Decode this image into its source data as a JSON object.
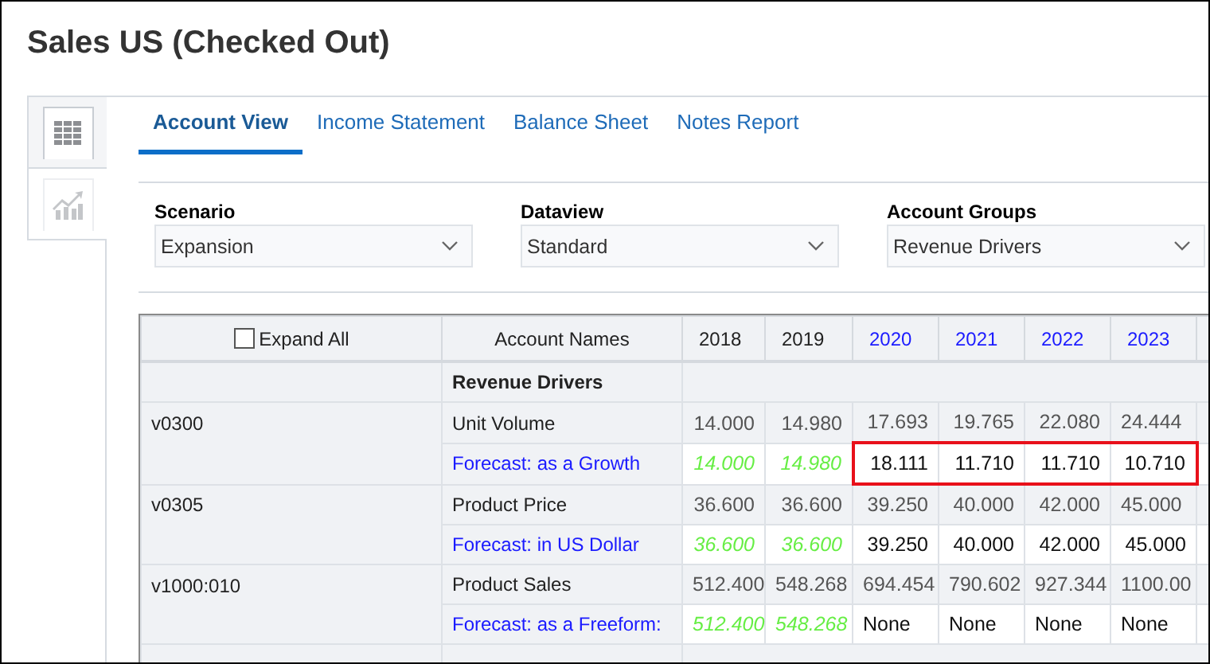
{
  "title": "Sales US (Checked Out)",
  "side_tabs": [
    {
      "kind": "grid",
      "selected": true
    },
    {
      "kind": "chart",
      "selected": false
    }
  ],
  "tabs": [
    {
      "label": "Account View",
      "selected": true
    },
    {
      "label": "Income Statement",
      "selected": false
    },
    {
      "label": "Balance Sheet",
      "selected": false
    },
    {
      "label": "Notes Report",
      "selected": false
    }
  ],
  "filters": [
    {
      "label": "Scenario",
      "value": "Expansion"
    },
    {
      "label": "Dataview",
      "value": "Standard"
    },
    {
      "label": "Account Groups",
      "value": "Revenue Drivers"
    }
  ],
  "table": {
    "expand_all": {
      "label": "Expand All",
      "checked": false
    },
    "name_header": "Account Names",
    "years": [
      {
        "label": "2018",
        "forecast": false
      },
      {
        "label": "2019",
        "forecast": false
      },
      {
        "label": "2020",
        "forecast": true
      },
      {
        "label": "2021",
        "forecast": true
      },
      {
        "label": "2022",
        "forecast": true
      },
      {
        "label": "2023",
        "forecast": true
      }
    ],
    "rows": [
      {
        "kind": "group",
        "name": "Revenue Drivers"
      },
      {
        "kind": "account",
        "code": "v0300",
        "name": "Unit Volume",
        "values": [
          "14.000",
          "14.980",
          "17.693",
          "19.765",
          "22.080",
          "24.444"
        ]
      },
      {
        "kind": "forecast",
        "name": "Forecast: as a Growth",
        "highlighted": true,
        "values": [
          {
            "text": "14.000",
            "kind": "history"
          },
          {
            "text": "14.980",
            "kind": "history"
          },
          {
            "text": "18.111",
            "kind": "input"
          },
          {
            "text": "11.710",
            "kind": "input"
          },
          {
            "text": "11.710",
            "kind": "input"
          },
          {
            "text": "10.710",
            "kind": "input"
          }
        ]
      },
      {
        "kind": "account",
        "code": "v0305",
        "name": "Product Price",
        "values": [
          "36.600",
          "36.600",
          "39.250",
          "40.000",
          "42.000",
          "45.000"
        ]
      },
      {
        "kind": "forecast",
        "name": "Forecast: in US Dollar",
        "highlighted": false,
        "values": [
          {
            "text": "36.600",
            "kind": "history"
          },
          {
            "text": "36.600",
            "kind": "history"
          },
          {
            "text": "39.250",
            "kind": "input"
          },
          {
            "text": "40.000",
            "kind": "input"
          },
          {
            "text": "42.000",
            "kind": "input"
          },
          {
            "text": "45.000",
            "kind": "input"
          }
        ]
      },
      {
        "kind": "account",
        "code": "v1000:010",
        "name": "Product Sales",
        "values": [
          "512.400",
          "548.268",
          "694.454",
          "790.602",
          "927.344",
          "1100.00"
        ]
      },
      {
        "kind": "forecast",
        "name": "Forecast: as a Freeform:",
        "highlighted": false,
        "values": [
          {
            "text": "512.400",
            "kind": "history"
          },
          {
            "text": "548.268",
            "kind": "history"
          },
          {
            "text": "None",
            "kind": "input"
          },
          {
            "text": "None",
            "kind": "input"
          },
          {
            "text": "None",
            "kind": "input"
          },
          {
            "text": "None",
            "kind": "input"
          }
        ]
      }
    ]
  }
}
